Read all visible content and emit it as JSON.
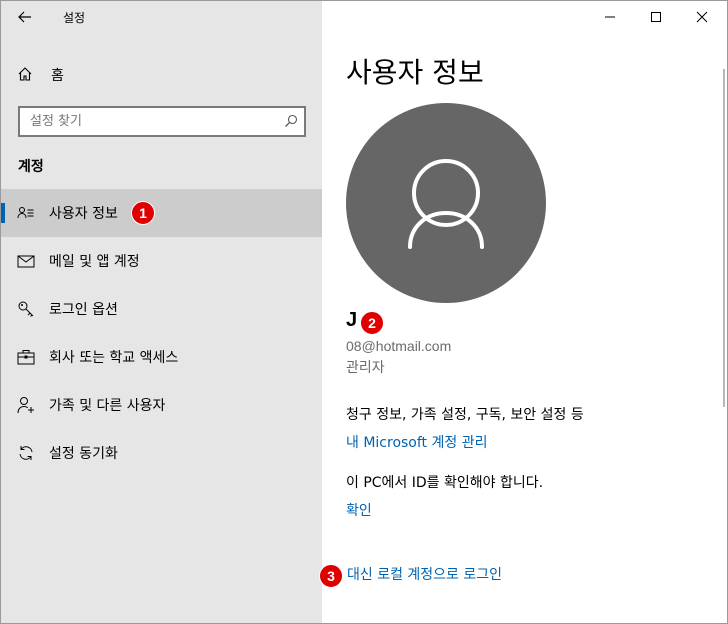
{
  "window": {
    "app_title": "설정"
  },
  "sidebar": {
    "home_label": "홈",
    "search_placeholder": "설정 찾기",
    "section_title": "계정",
    "items": [
      {
        "label": "사용자 정보",
        "icon": "person-card-icon",
        "active": true
      },
      {
        "label": "메일 및 앱 계정",
        "icon": "mail-icon",
        "active": false
      },
      {
        "label": "로그인 옵션",
        "icon": "key-icon",
        "active": false
      },
      {
        "label": "회사 또는 학교 액세스",
        "icon": "briefcase-icon",
        "active": false
      },
      {
        "label": "가족 및 다른 사용자",
        "icon": "add-person-icon",
        "active": false
      },
      {
        "label": "설정 동기화",
        "icon": "sync-icon",
        "active": false
      }
    ]
  },
  "main": {
    "title": "사용자 정보",
    "user": {
      "name": "J",
      "email": "08@hotmail.com",
      "role": "관리자"
    },
    "billing_text": "청구 정보, 가족 설정, 구독, 보안 설정 등",
    "manage_link": "내 Microsoft 계정 관리",
    "verify_text": "이 PC에서 ID를 확인해야 합니다.",
    "verify_link": "확인",
    "local_login_link": "대신 로컬 계정으로 로그인"
  },
  "annotations": {
    "badge1": "1",
    "badge2": "2",
    "badge3": "3"
  },
  "colors": {
    "accent": "#0063b1",
    "sidebar_bg": "#e6e6e6",
    "active_bg": "#cccccc",
    "badge": "#e00000",
    "avatar": "#666666"
  }
}
